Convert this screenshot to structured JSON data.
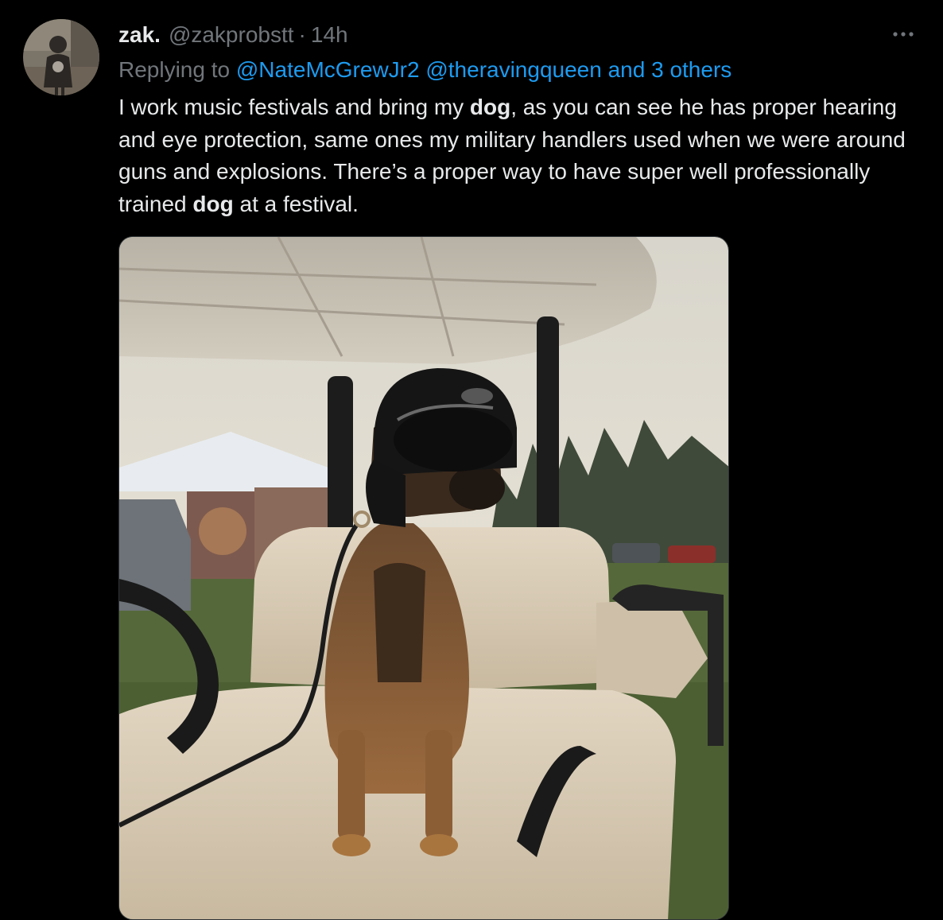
{
  "tweet": {
    "display_name": "zak.",
    "handle": "@zakprobstt",
    "separator": "·",
    "time": "14h",
    "more_icon": "more-horizontal-icon",
    "reply": {
      "prefix": "Replying to",
      "mentions": [
        "@NateMcGrewJr2",
        "@theravingqueen"
      ],
      "others": "and 3 others"
    },
    "text": {
      "part1": "I work music festivals and bring my ",
      "bold1": "dog",
      "part2": ", as you can see he has proper hearing and eye protection, same ones my military handlers used when we were around guns and explosions. There’s a proper way to have super well professionally trained ",
      "bold2": "dog",
      "part3": " at a festival."
    },
    "media": {
      "description_icon": "photo-dog-on-golf-cart"
    }
  },
  "colors": {
    "background": "#000000",
    "primary_text": "#e7e9ea",
    "secondary_text": "#71767b",
    "link": "#1d9bf0"
  }
}
